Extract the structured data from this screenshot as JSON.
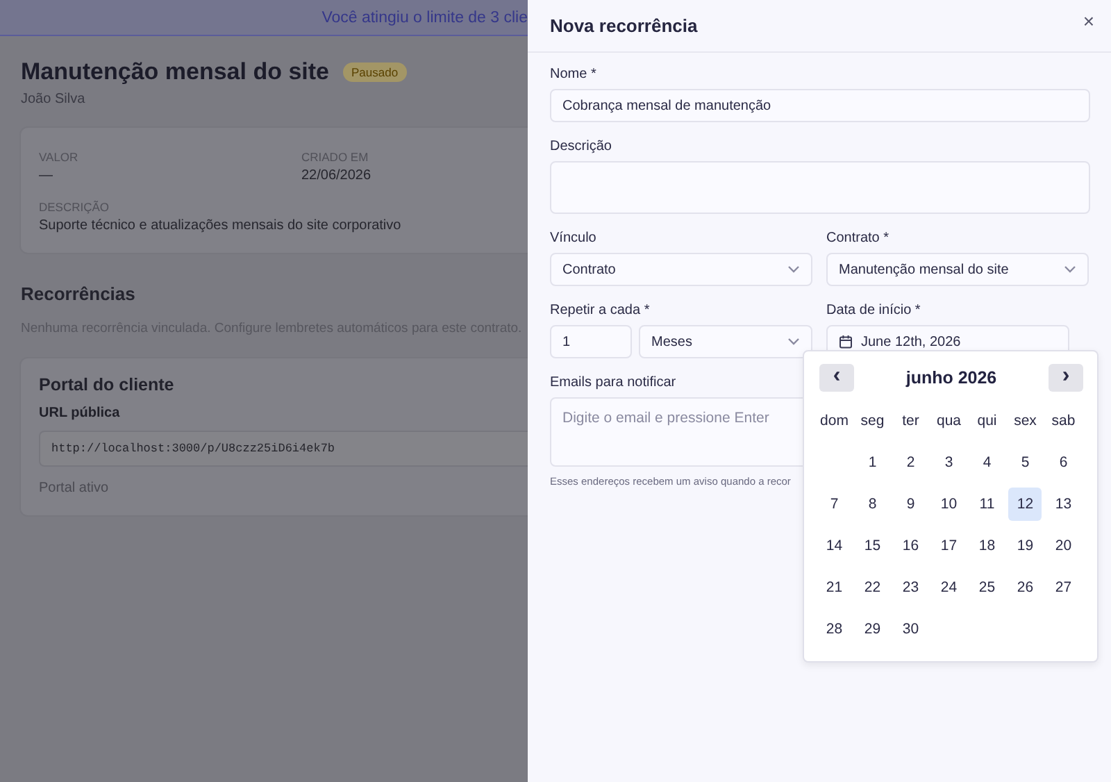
{
  "banner": {
    "text": "Você atingiu o limite de 3 clie"
  },
  "page": {
    "title": "Manutenção mensal do site",
    "status": "Pausado",
    "client": "João Silva",
    "details": [
      {
        "label": "VALOR",
        "value": "—"
      },
      {
        "label": "CRIADO EM",
        "value": "22/06/2026"
      }
    ],
    "description": {
      "label": "DESCRIÇÃO",
      "value": "Suporte técnico e atualizações mensais do site corporativo"
    },
    "recurrences": {
      "title": "Recorrências",
      "empty": "Nenhuma recorrência vinculada. Configure lembretes automáticos para este contrato."
    },
    "portal": {
      "title": "Portal do cliente",
      "url_label": "URL pública",
      "url": "http://localhost:3000/p/U8czz25iD6i4ek7b",
      "status": "Portal ativo"
    }
  },
  "drawer": {
    "title": "Nova recorrência",
    "close": "×",
    "name": {
      "label": "Nome *",
      "value": "Cobrança mensal de manutenção"
    },
    "description": {
      "label": "Descrição"
    },
    "link": {
      "label": "Vínculo",
      "value": "Contrato"
    },
    "contract": {
      "label": "Contrato *",
      "value": "Manutenção mensal do site"
    },
    "repeat": {
      "label": "Repetir a cada *",
      "value": "1",
      "unit": "Meses"
    },
    "start_date": {
      "label": "Data de início *",
      "value": "June 12th, 2026"
    },
    "emails": {
      "label": "Emails para notificar",
      "placeholder": "Digite o email e pressione Enter",
      "hint": "Esses endereços recebem um aviso quando a recor"
    }
  },
  "calendar": {
    "prev": "‹",
    "next": "›",
    "month": "junho 2026",
    "weekdays": [
      "dom",
      "seg",
      "ter",
      "qua",
      "qui",
      "sex",
      "sab"
    ],
    "weeks": [
      [
        {
          "day": "1",
          "selected": false
        },
        {
          "day": "2",
          "selected": false
        },
        {
          "day": "3",
          "selected": false
        },
        {
          "day": "4",
          "selected": false
        },
        {
          "day": "5",
          "selected": false
        },
        {
          "day": "6",
          "selected": false
        }
      ],
      [
        {
          "day": "7",
          "selected": false
        },
        {
          "day": "8",
          "selected": false
        },
        {
          "day": "9",
          "selected": false
        },
        {
          "day": "10",
          "selected": false
        },
        {
          "day": "11",
          "selected": false
        },
        {
          "day": "12",
          "selected": true
        },
        {
          "day": "13",
          "selected": false
        }
      ],
      [
        {
          "day": "14",
          "selected": false
        },
        {
          "day": "15",
          "selected": false
        },
        {
          "day": "16",
          "selected": false
        },
        {
          "day": "17",
          "selected": false
        },
        {
          "day": "18",
          "selected": false
        },
        {
          "day": "19",
          "selected": false
        },
        {
          "day": "20",
          "selected": false
        }
      ],
      [
        {
          "day": "21",
          "selected": false
        },
        {
          "day": "22",
          "selected": false
        },
        {
          "day": "23",
          "selected": false
        },
        {
          "day": "24",
          "selected": false
        },
        {
          "day": "25",
          "selected": false
        },
        {
          "day": "26",
          "selected": false
        },
        {
          "day": "27",
          "selected": false
        }
      ],
      [
        {
          "day": "28",
          "selected": false
        },
        {
          "day": "29",
          "selected": false
        },
        {
          "day": "30",
          "selected": false
        }
      ]
    ]
  }
}
